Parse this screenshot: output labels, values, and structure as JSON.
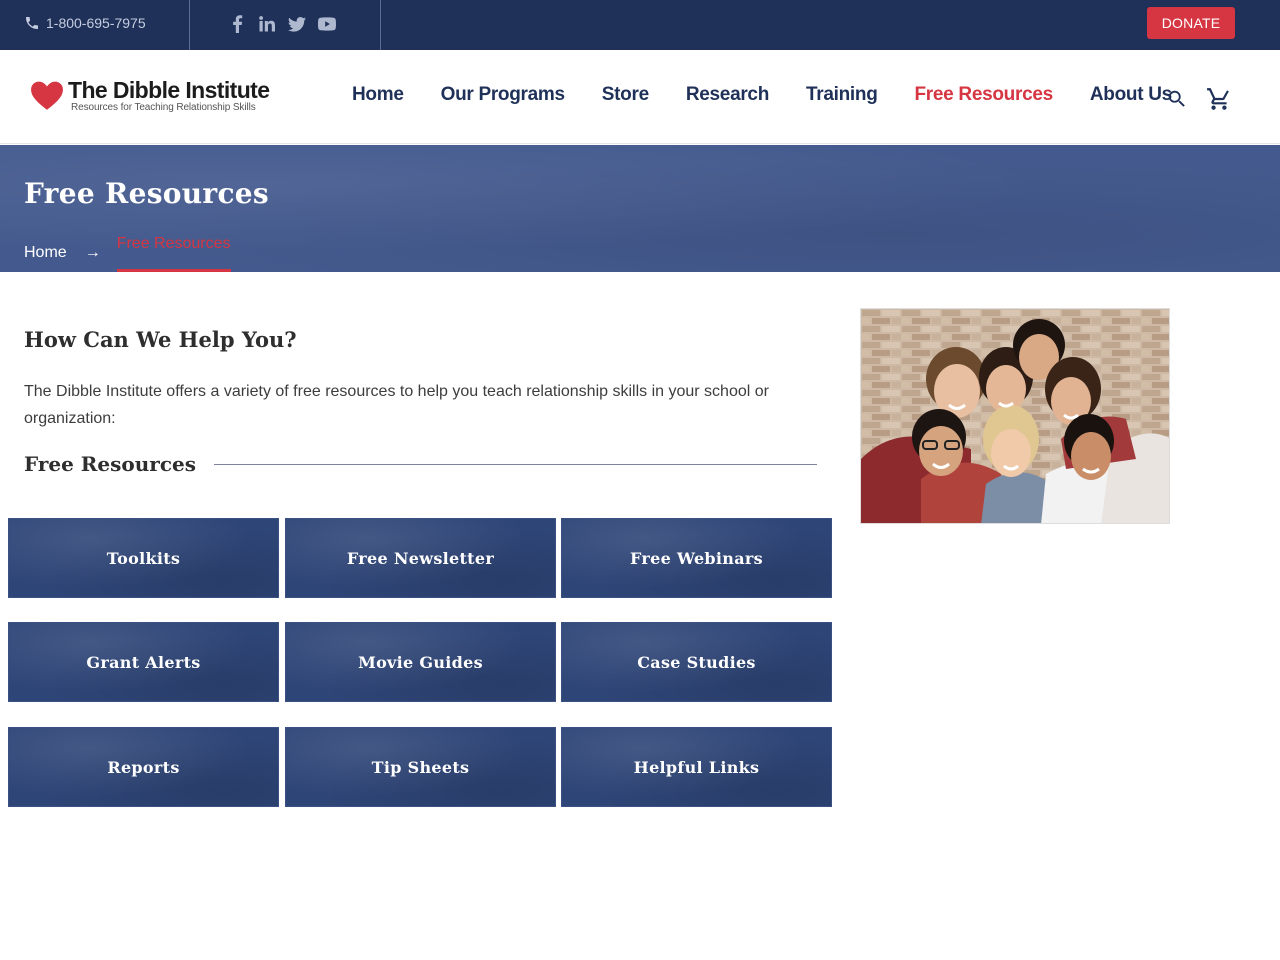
{
  "topbar": {
    "phone": "1-800-695-7975",
    "socials": [
      "facebook-icon",
      "linkedin-icon",
      "twitter-icon",
      "youtube-icon"
    ],
    "donate_label": "DONATE"
  },
  "header": {
    "logo_name": "The Dibble Institute",
    "logo_tagline": "Resources for Teaching Relationship Skills",
    "nav": [
      {
        "label": "Home"
      },
      {
        "label": "Our Programs"
      },
      {
        "label": "Store"
      },
      {
        "label": "Research"
      },
      {
        "label": "Training"
      },
      {
        "label": "Free Resources",
        "active": true
      },
      {
        "label": "About Us"
      }
    ]
  },
  "banner": {
    "title": "Free Resources",
    "breadcrumb_home": "Home",
    "breadcrumb_arrow": "→",
    "breadcrumb_current": "Free Resources"
  },
  "content": {
    "help_heading": "How Can We Help You?",
    "intro": "The Dibble Institute offers a variety of free resources to help you teach relationship skills in your school or organization:",
    "section_heading": "Free Resources",
    "tiles": [
      "Toolkits",
      "Free Newsletter",
      "Free Webinars",
      "Grant Alerts",
      "Movie Guides",
      "Case Studies",
      "Reports",
      "Tip Sheets",
      "Helpful Links"
    ]
  },
  "colors": {
    "navy": "#1f3158",
    "accent_red": "#d63542",
    "banner_blue": "#445a8e",
    "tile_blue": "#2e4577"
  }
}
